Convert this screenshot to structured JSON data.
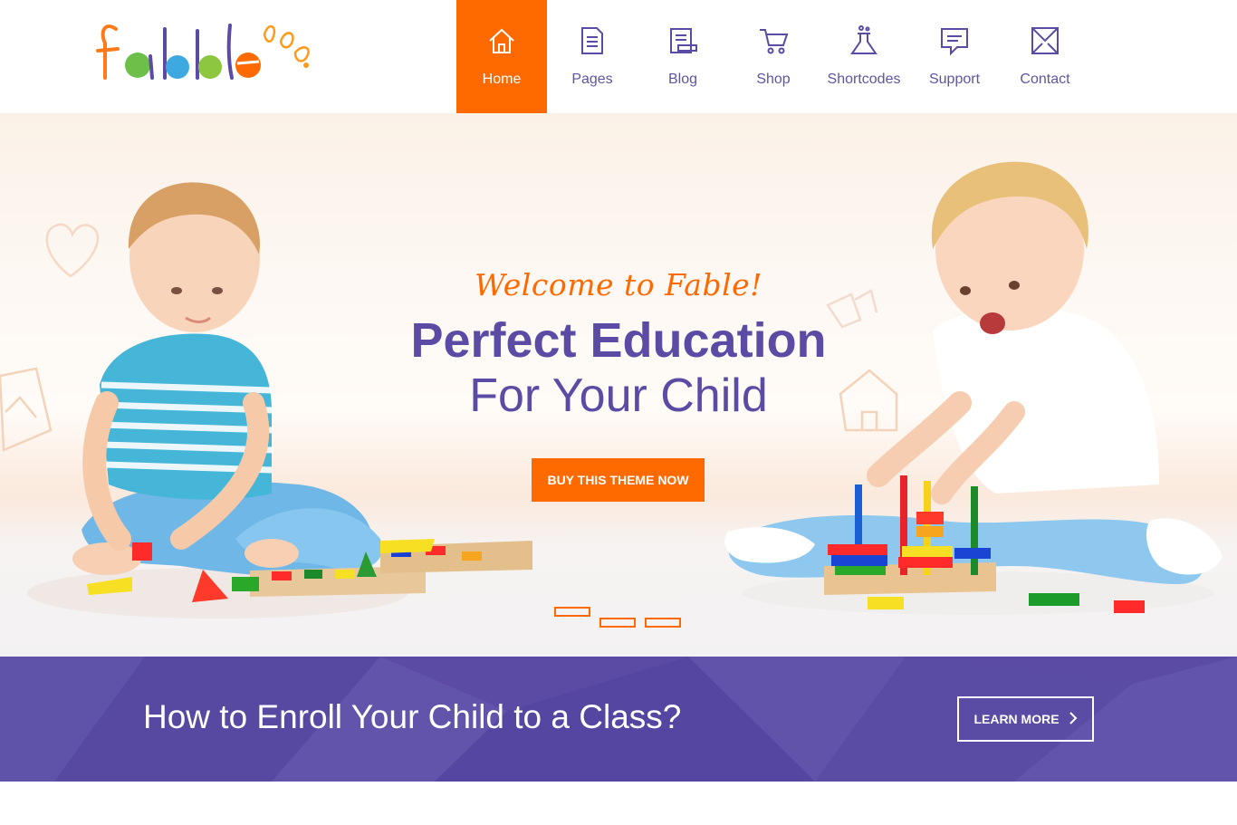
{
  "header": {
    "nav": [
      {
        "label": "Home",
        "icon": "home-icon",
        "active": true
      },
      {
        "label": "Pages",
        "icon": "pages-icon",
        "active": false
      },
      {
        "label": "Blog",
        "icon": "blog-icon",
        "active": false
      },
      {
        "label": "Shop",
        "icon": "cart-icon",
        "active": false
      },
      {
        "label": "Shortcodes",
        "icon": "flask-icon",
        "active": false
      },
      {
        "label": "Support",
        "icon": "chat-icon",
        "active": false
      },
      {
        "label": "Contact",
        "icon": "envelope-icon",
        "active": false
      }
    ]
  },
  "hero": {
    "welcome": "Welcome to Fable!",
    "title": "Perfect Education",
    "subtitle": "For Your Child",
    "button_label": "BUY THIS THEME NOW",
    "slides_count": 3,
    "active_slide": 1
  },
  "banner": {
    "text": "How to Enroll Your Child to a Class?",
    "button_label": "LEARN MORE"
  },
  "colors": {
    "accent": "#ff6a00",
    "brand": "#5b4ba4",
    "nav_text": "#5e55a3"
  }
}
